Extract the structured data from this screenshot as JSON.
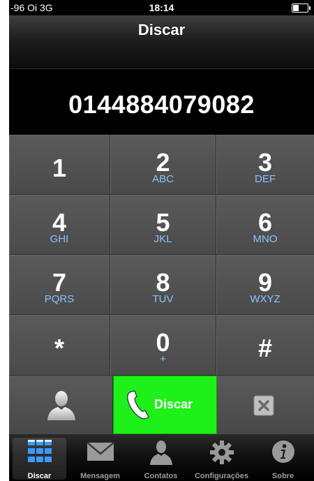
{
  "status_bar": {
    "carrier": "-96 Oi  3G",
    "time": "18:14"
  },
  "nav": {
    "title": "Discar"
  },
  "display": {
    "number": "01448840790​82"
  },
  "keypad": [
    {
      "digit": "1",
      "letters": ""
    },
    {
      "digit": "2",
      "letters": "ABC"
    },
    {
      "digit": "3",
      "letters": "DEF"
    },
    {
      "digit": "4",
      "letters": "GHI"
    },
    {
      "digit": "5",
      "letters": "JKL"
    },
    {
      "digit": "6",
      "letters": "MNO"
    },
    {
      "digit": "7",
      "letters": "PQRS"
    },
    {
      "digit": "8",
      "letters": "TUV"
    },
    {
      "digit": "9",
      "letters": "WXYZ"
    },
    {
      "digit": "*",
      "letters": ""
    },
    {
      "digit": "0",
      "letters": "+"
    },
    {
      "digit": "#",
      "letters": ""
    }
  ],
  "actions": {
    "call_label": "Discar",
    "call_color": "#1ef11a"
  },
  "tabs": [
    {
      "label": "Discar",
      "icon": "keypad-grid-icon",
      "active": true
    },
    {
      "label": "Mensagem",
      "icon": "envelope-icon",
      "active": false
    },
    {
      "label": "Contatos",
      "icon": "person-icon",
      "active": false
    },
    {
      "label": "Configurações",
      "icon": "gear-icon",
      "active": false
    },
    {
      "label": "Sobre",
      "icon": "info-icon",
      "active": false
    }
  ]
}
